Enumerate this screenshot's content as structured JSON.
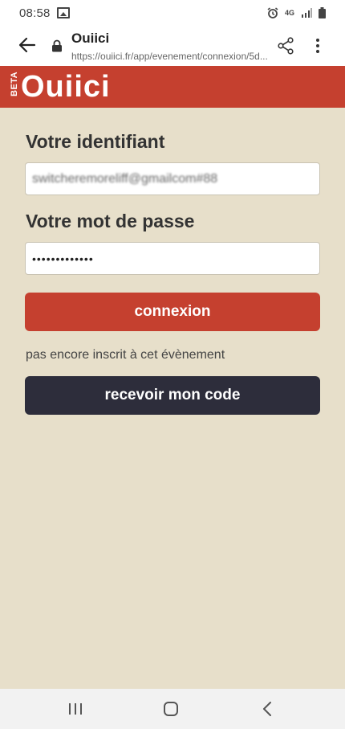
{
  "status": {
    "time": "08:58",
    "network": "4G"
  },
  "browser": {
    "page_title": "Ouiici",
    "url": "https://ouiici.fr/app/evenement/connexion/5d..."
  },
  "site": {
    "beta": "BETA",
    "logo": "Ouiici",
    "brand_color": "#c5402f"
  },
  "form": {
    "identifier_label": "Votre identifiant",
    "identifier_value": "switcheremoreliff@gmailcom#88",
    "password_label": "Votre mot de passe",
    "password_value": "•••••••••••••",
    "login_button": "connexion",
    "not_registered_text": "pas encore inscrit à cet évènement",
    "code_button": "recevoir mon code"
  },
  "colors": {
    "background": "#e7dfca",
    "login_button": "#c5402f",
    "code_button": "#2d2d3b"
  },
  "icons": {
    "back": "arrow-left",
    "lock": "lock",
    "share": "share",
    "menu": "more-vertical",
    "nav_recents": "recents",
    "nav_home": "home",
    "nav_back": "chevron-left"
  }
}
